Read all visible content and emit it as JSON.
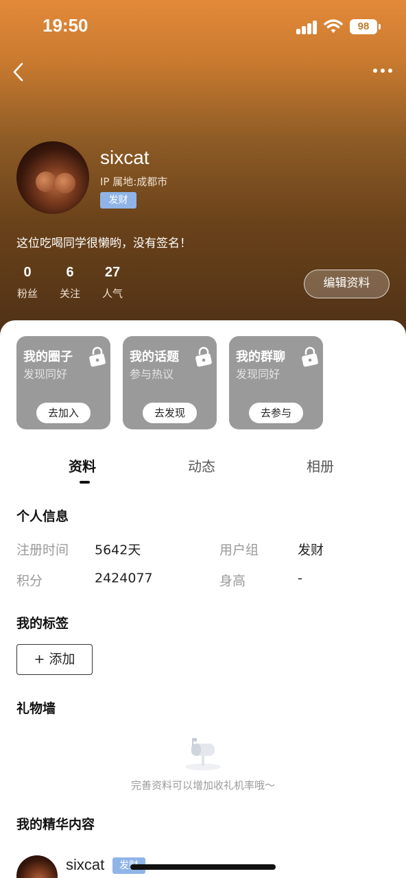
{
  "status_bar": {
    "time": "19:50",
    "battery": "98"
  },
  "profile": {
    "username": "sixcat",
    "ip_location": "IP 属地:成都市",
    "group_badge": "发财",
    "bio": "这位吃喝同学很懒哟，没有签名！",
    "stats": [
      {
        "value": "0",
        "label": "粉丝"
      },
      {
        "value": "6",
        "label": "关注"
      },
      {
        "value": "27",
        "label": "人气"
      }
    ],
    "edit_button": "编辑资料"
  },
  "cards": [
    {
      "title": "我的圈子",
      "subtitle": "发现同好",
      "button": "去加入"
    },
    {
      "title": "我的话题",
      "subtitle": "参与热议",
      "button": "去发现"
    },
    {
      "title": "我的群聊",
      "subtitle": "发现同好",
      "button": "去参与"
    }
  ],
  "tabs": [
    {
      "label": "资料",
      "active": true
    },
    {
      "label": "动态",
      "active": false
    },
    {
      "label": "相册",
      "active": false
    }
  ],
  "personal_info": {
    "title": "个人信息",
    "rows": [
      {
        "label": "注册时间",
        "value": "5642天"
      },
      {
        "label": "用户组",
        "value": "发财"
      },
      {
        "label": "积分",
        "value": "2424077"
      },
      {
        "label": "身高",
        "value": "-"
      }
    ]
  },
  "tags_section": {
    "title": "我的标签",
    "add_button": "+ 添加"
  },
  "gift_wall": {
    "title": "礼物墙",
    "empty_text": "完善资料可以增加收礼机率哦～"
  },
  "featured": {
    "title": "我的精华内容",
    "post_user": "sixcat",
    "post_badge": "发财"
  },
  "colors": {
    "header_gradient_top": "#e3893a",
    "header_gradient_bottom": "#4d3016",
    "badge": "#8fb4e8",
    "card_bg": "#9a9a9a"
  }
}
